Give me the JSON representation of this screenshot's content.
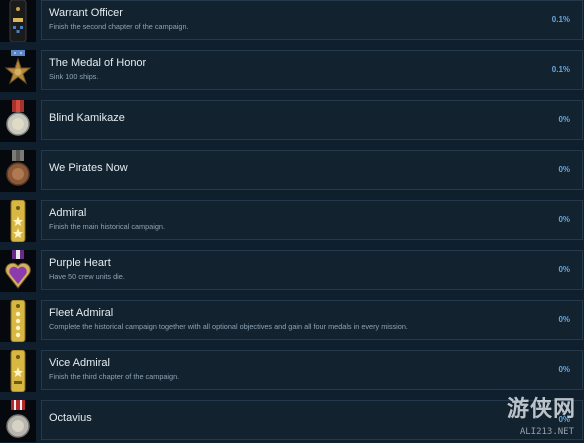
{
  "achievements": [
    {
      "title": "Warrant Officer",
      "description": "Finish the second chapter of the campaign.",
      "percent": "0.1%",
      "icon": "warrant-officer-shoulder-board-icon"
    },
    {
      "title": "The Medal of Honor",
      "description": "Sink 100 ships.",
      "percent": "0.1%",
      "icon": "medal-of-honor-star-icon"
    },
    {
      "title": "Blind Kamikaze",
      "description": "",
      "percent": "0%",
      "icon": "silver-medal-icon"
    },
    {
      "title": "We Pirates Now",
      "description": "",
      "percent": "0%",
      "icon": "bronze-medal-icon"
    },
    {
      "title": "Admiral",
      "description": "Finish the main historical campaign.",
      "percent": "0%",
      "icon": "admiral-shoulder-board-icon"
    },
    {
      "title": "Purple Heart",
      "description": "Have 50 crew units die.",
      "percent": "0%",
      "icon": "purple-heart-medal-icon"
    },
    {
      "title": "Fleet Admiral",
      "description": "Complete the historical campaign together with all optional objectives and gain all four medals in every mission.",
      "percent": "0%",
      "icon": "fleet-admiral-shoulder-board-icon"
    },
    {
      "title": "Vice Admiral",
      "description": "Finish the third chapter of the campaign.",
      "percent": "0%",
      "icon": "vice-admiral-shoulder-board-icon"
    },
    {
      "title": "Octavius",
      "description": "",
      "percent": "0%",
      "icon": "ribbon-medal-icon"
    }
  ],
  "watermark": {
    "text": "游侠网",
    "sub": "ALI213.NET"
  },
  "colors": {
    "background": "#0f1f2d",
    "card": "#13222f",
    "percent": "#66a7de"
  }
}
